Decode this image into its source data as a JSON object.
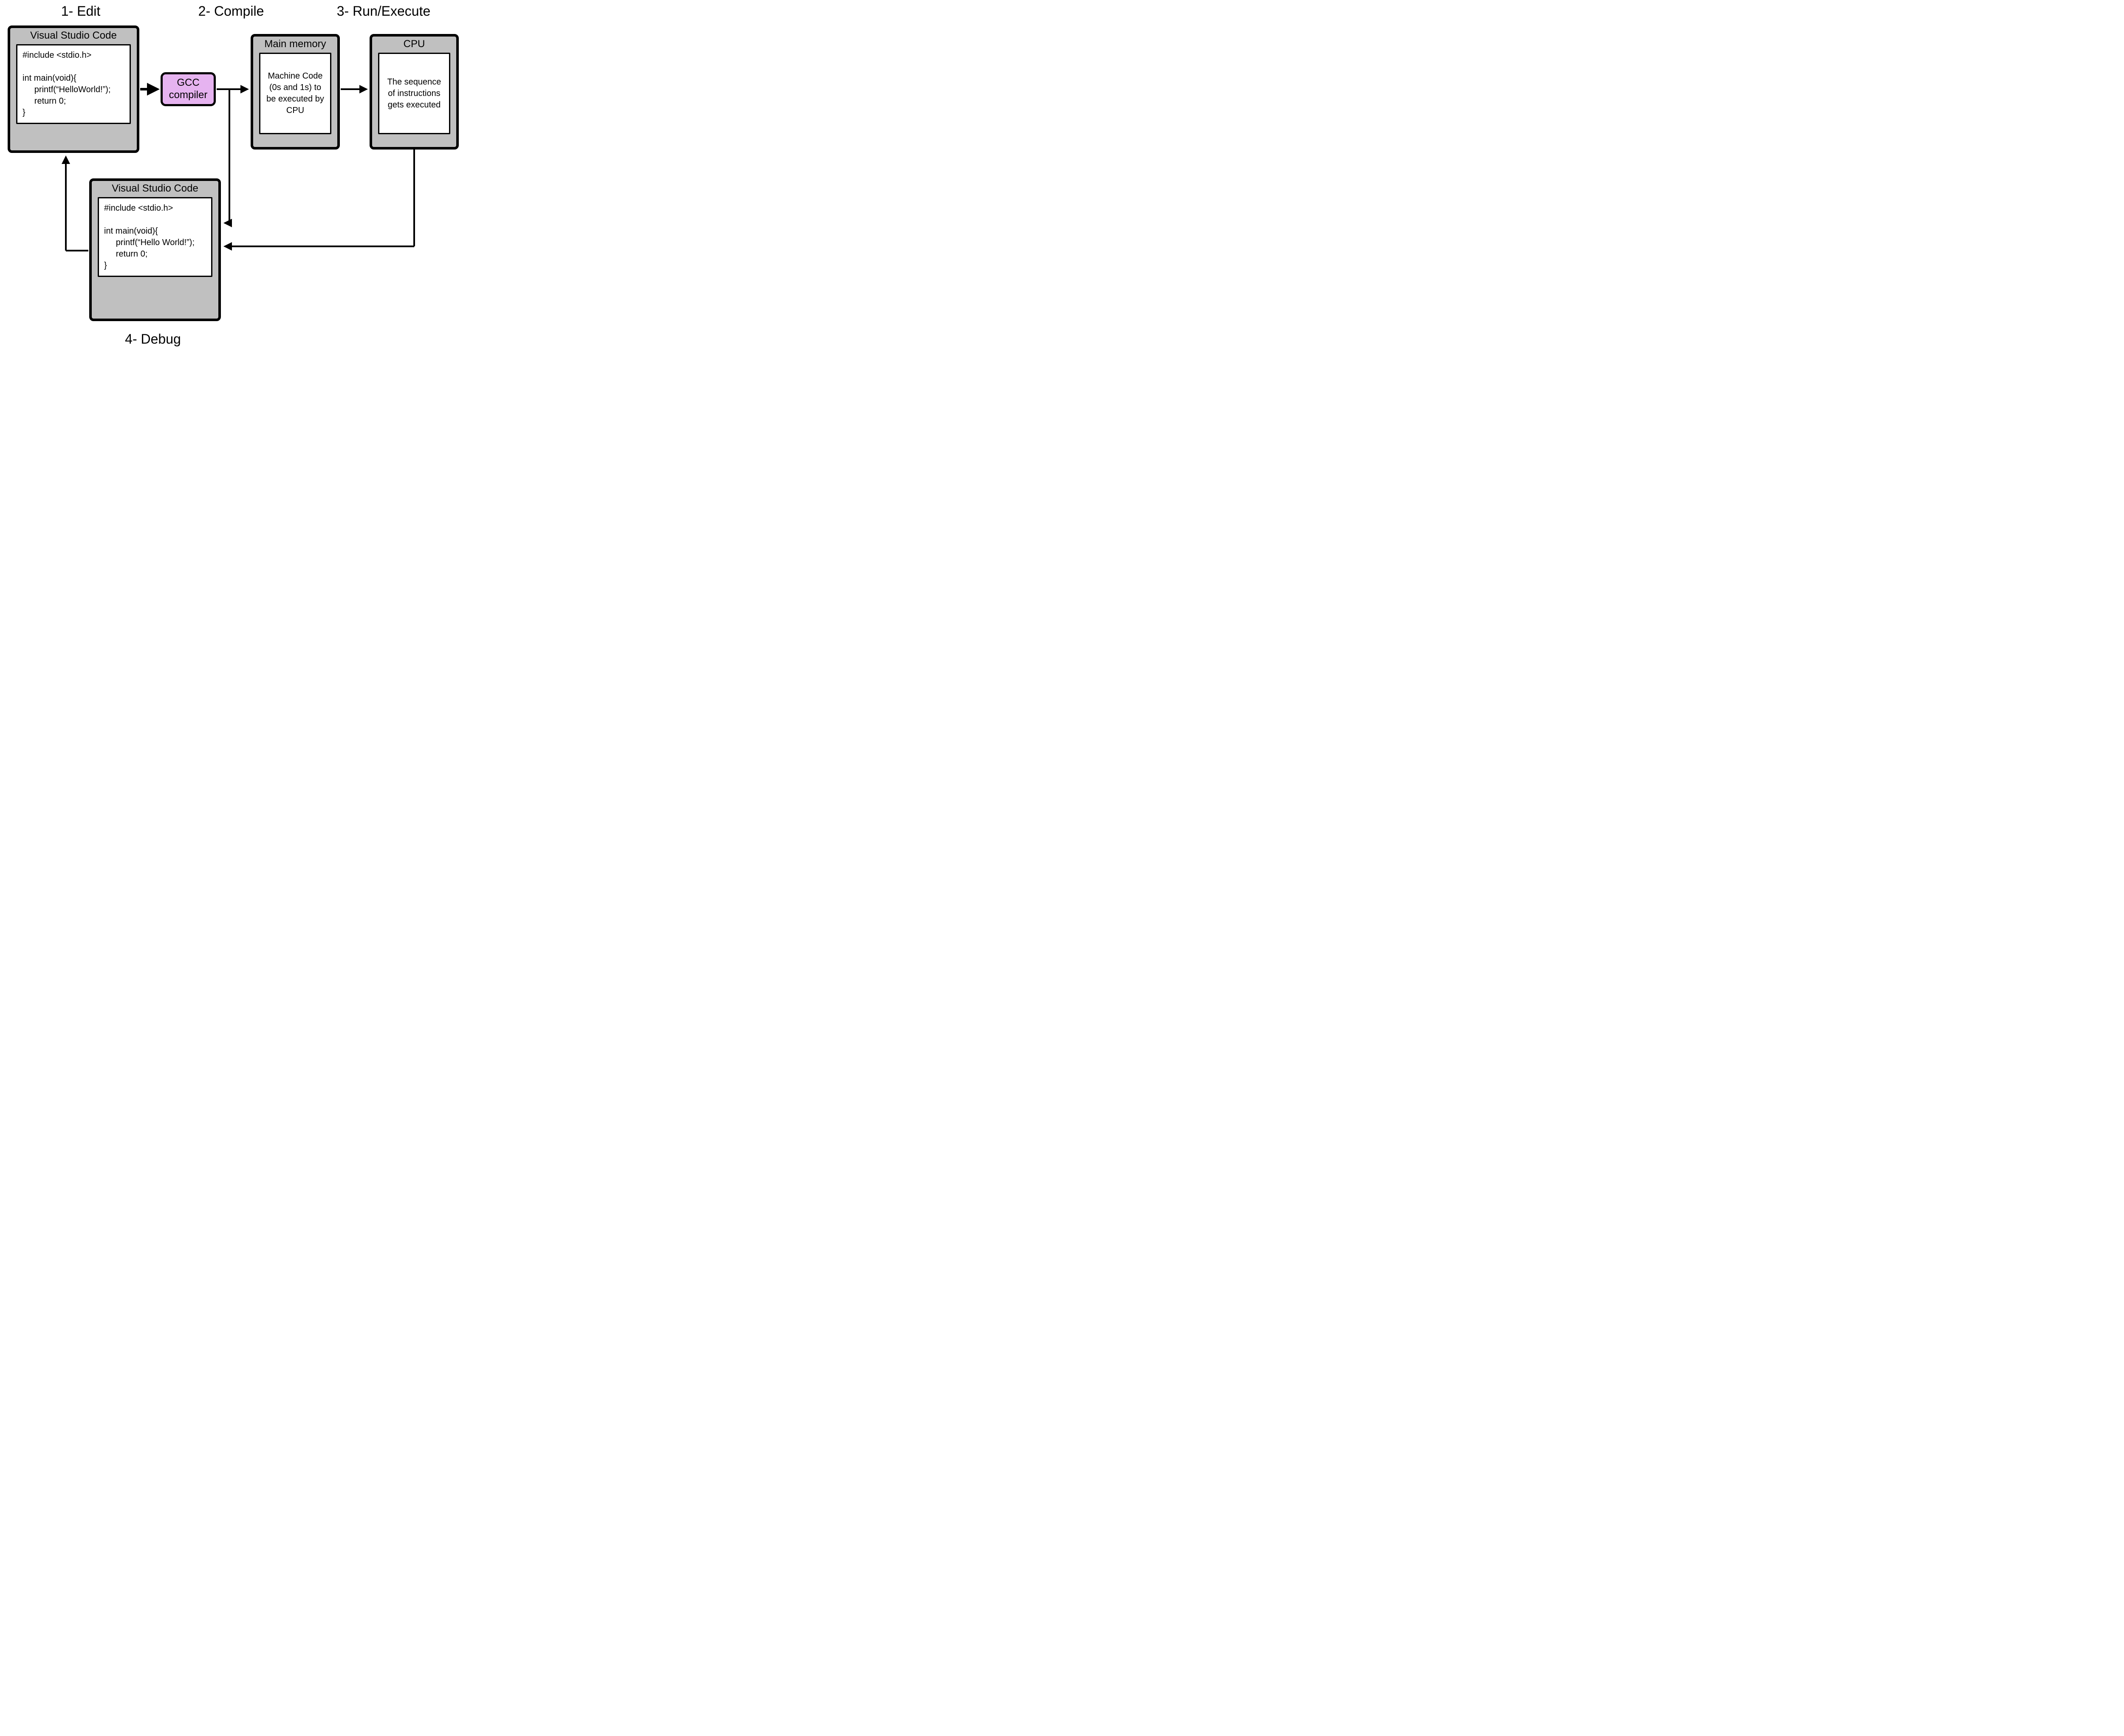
{
  "steps": {
    "edit": "1- Edit",
    "compile": "2- Compile",
    "run": "3- Run/Execute",
    "debug": "4- Debug"
  },
  "boxes": {
    "edit": {
      "title": "Visual Studio Code",
      "code": "#include <stdio.h>\n\nint main(void){\n     printf(“HelloWorld!”);\n     return 0;\n}"
    },
    "compile": {
      "label": "GCC\ncompiler"
    },
    "memory": {
      "title": "Main memory",
      "text": "Machine Code (0s and 1s) to be executed by CPU"
    },
    "cpu": {
      "title": "CPU",
      "text": "The sequence of instructions gets executed"
    },
    "debug": {
      "title": "Visual Studio Code",
      "code": "#include <stdio.h>\n\nint main(void){\n     printf(“Hello World!”);\n     return 0;\n}"
    }
  },
  "colors": {
    "box_fill": "#c0c0c0",
    "compiler_fill": "#e6b3f0",
    "border": "#000000",
    "inner_fill": "#ffffff"
  }
}
